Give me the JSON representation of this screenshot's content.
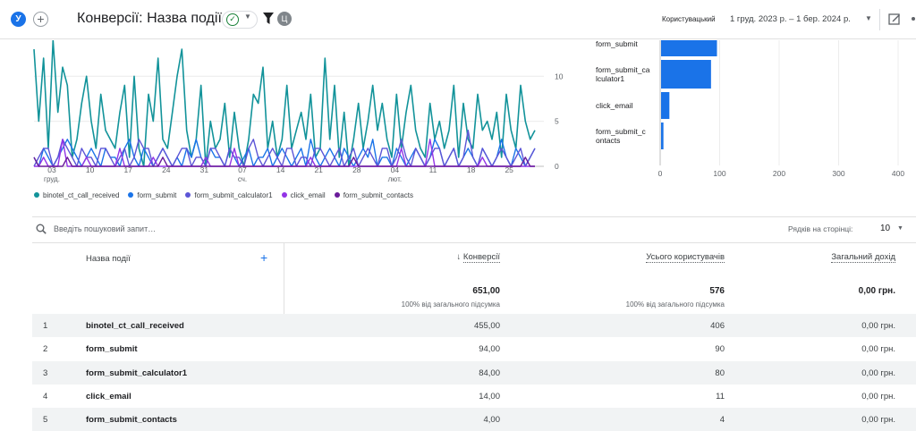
{
  "header": {
    "avatar": "У",
    "add": "+",
    "title": "Конверсії: Назва події",
    "filter_chip": "Ц",
    "comparison_label": "Користувацький",
    "date_range": "1 груд. 2023 р. – 1 бер. 2024 р."
  },
  "colors": {
    "series": [
      "#12939a",
      "#1a73e8",
      "#5c55d6",
      "#9334e6",
      "#6a1b9a"
    ],
    "accent": "#1a73e8",
    "row_shade": "#f1f3f4"
  },
  "chart_data": [
    {
      "type": "line",
      "x_ticks": [
        {
          "day": "03",
          "month": "груд."
        },
        {
          "day": "10",
          "month": ""
        },
        {
          "day": "17",
          "month": ""
        },
        {
          "day": "24",
          "month": ""
        },
        {
          "day": "31",
          "month": ""
        },
        {
          "day": "07",
          "month": "сч."
        },
        {
          "day": "14",
          "month": ""
        },
        {
          "day": "21",
          "month": ""
        },
        {
          "day": "28",
          "month": ""
        },
        {
          "day": "04",
          "month": "лют."
        },
        {
          "day": "11",
          "month": ""
        },
        {
          "day": "18",
          "month": ""
        },
        {
          "day": "25",
          "month": ""
        }
      ],
      "y_ticks": [
        "0",
        "5",
        "10"
      ],
      "ylim": [
        0,
        14
      ],
      "series": [
        {
          "name": "binotel_ct_call_received",
          "values": [
            13,
            5,
            12,
            2,
            14,
            6,
            11,
            9,
            1,
            3,
            7,
            10,
            5,
            2,
            8,
            4,
            3,
            2,
            6,
            9,
            1,
            10,
            2,
            0,
            8,
            5,
            12,
            3,
            2,
            6,
            10,
            13,
            4,
            1,
            3,
            9,
            0,
            5,
            2,
            3,
            7,
            1,
            6,
            2,
            0,
            3,
            8,
            7,
            11,
            2,
            5,
            1,
            3,
            9,
            2,
            4,
            6,
            3,
            8,
            1,
            2,
            12,
            3,
            9,
            1,
            6,
            0,
            3,
            7,
            2,
            5,
            9,
            4,
            7,
            3,
            1,
            8,
            2,
            6,
            9,
            4,
            2,
            1,
            7,
            3,
            5,
            2,
            4,
            9,
            1,
            7,
            3,
            2,
            8,
            4,
            5,
            3,
            6,
            1,
            8,
            4,
            2,
            9,
            5,
            3,
            4
          ]
        },
        {
          "name": "form_submit",
          "values": [
            1,
            0,
            2,
            1,
            0,
            1,
            2,
            3,
            2,
            1,
            0,
            1,
            2,
            1,
            0,
            2,
            1,
            1,
            0,
            2,
            3,
            1,
            0,
            2,
            1,
            0,
            1,
            2,
            1,
            0,
            1,
            0,
            2,
            1,
            3,
            1,
            0,
            2,
            1,
            1,
            0,
            2,
            1,
            0,
            1,
            2,
            0,
            1,
            1,
            2,
            0,
            1,
            2,
            1,
            0,
            1,
            2,
            0,
            3,
            1,
            0,
            1,
            2,
            1,
            0,
            2,
            1,
            0,
            1,
            2,
            1,
            3,
            0,
            1,
            1,
            0,
            2,
            1,
            0,
            1,
            2,
            1,
            0,
            1,
            3,
            2,
            0,
            1,
            2,
            0,
            1,
            2,
            1,
            0,
            2,
            1,
            0,
            1,
            3,
            1,
            0,
            2,
            1,
            0,
            1,
            2
          ]
        },
        {
          "name": "form_submit_calculator1",
          "values": [
            0,
            1,
            2,
            2,
            0,
            1,
            3,
            2,
            1,
            0,
            2,
            1,
            1,
            0,
            2,
            2,
            1,
            0,
            1,
            2,
            0,
            1,
            3,
            2,
            2,
            0,
            1,
            2,
            1,
            0,
            1,
            2,
            2,
            0,
            1,
            1,
            0,
            2,
            2,
            1,
            0,
            2,
            1,
            1,
            0,
            2,
            3,
            1,
            0,
            1,
            2,
            1,
            0,
            2,
            2,
            0,
            1,
            1,
            0,
            2,
            2,
            1,
            0,
            1,
            2,
            0,
            1,
            2,
            0,
            1,
            2,
            1,
            0,
            2,
            2,
            0,
            1,
            3,
            1,
            0,
            2,
            1,
            0,
            1,
            2,
            2,
            0,
            1,
            2,
            0,
            1,
            4,
            1,
            0,
            2,
            1,
            0,
            1,
            2,
            1,
            0,
            1,
            2,
            0,
            1,
            2
          ]
        },
        {
          "name": "click_email",
          "values": [
            0,
            0,
            1,
            0,
            0,
            0,
            3,
            0,
            0,
            0,
            0,
            1,
            0,
            0,
            0,
            0,
            0,
            0,
            2,
            0,
            0,
            0,
            0,
            0,
            0,
            1,
            0,
            0,
            0,
            0,
            0,
            0,
            0,
            0,
            0,
            0,
            1,
            0,
            0,
            0,
            0,
            0,
            2,
            0,
            0,
            0,
            0,
            0,
            0,
            0,
            0,
            0,
            0,
            0,
            0,
            0,
            0,
            0,
            1,
            0,
            0,
            0,
            0,
            0,
            0,
            0,
            0,
            0,
            0,
            0,
            0,
            0,
            0,
            0,
            0,
            0,
            0,
            2,
            0,
            0,
            0,
            0,
            0,
            3,
            0,
            0,
            0,
            0,
            0,
            0,
            0,
            0,
            0,
            0,
            1,
            0,
            0,
            0,
            0,
            0,
            0,
            0,
            0,
            0,
            0,
            0
          ]
        },
        {
          "name": "form_submit_contacts",
          "values": [
            1,
            0,
            0,
            0,
            0,
            0,
            0,
            1,
            0,
            0,
            0,
            0,
            0,
            0,
            0,
            0,
            0,
            0,
            0,
            0,
            0,
            0,
            0,
            0,
            0,
            0,
            0,
            1,
            0,
            0,
            0,
            0,
            0,
            0,
            0,
            0,
            0,
            0,
            0,
            0,
            0,
            0,
            0,
            0,
            0,
            0,
            0,
            0,
            0,
            0,
            0,
            0,
            0,
            0,
            0,
            0,
            0,
            0,
            0,
            0,
            0,
            0,
            0,
            0,
            0,
            0,
            0,
            1,
            0,
            0,
            0,
            0,
            0,
            0,
            0,
            0,
            0,
            0,
            0,
            0,
            0,
            0,
            0,
            0,
            0,
            0,
            0,
            0,
            0,
            0,
            0,
            0,
            0,
            0,
            0,
            0,
            0,
            0,
            0,
            0,
            0,
            0,
            0,
            1,
            0,
            0
          ]
        }
      ]
    },
    {
      "type": "bar",
      "orientation": "horizontal",
      "categories": [
        "form_submit",
        "form_submit_calculator1",
        "click_email",
        "form_submit_contacts"
      ],
      "category_labels": [
        [
          "form_submit"
        ],
        [
          "form_submit_ca",
          "lculator1"
        ],
        [
          "click_email"
        ],
        [
          "form_submit_c",
          "ontacts"
        ]
      ],
      "values": [
        94,
        84,
        14,
        4
      ],
      "x_ticks": [
        "0",
        "100",
        "200",
        "300",
        "400"
      ],
      "xlim": [
        0,
        400
      ]
    }
  ],
  "table": {
    "search_placeholder": "Введіть пошуковий запит…",
    "rows_per_page_label": "Рядків на сторінці:",
    "rows_per_page": "10",
    "add_dimension": "+",
    "columns": {
      "name": "Назва події",
      "conversions": "Конверсії",
      "users": "Усього користувачів",
      "revenue": "Загальний дохід"
    },
    "sort_arrow": "↓",
    "totals": {
      "conversions": "651,00",
      "conversions_sub": "100% від загального підсумка",
      "users": "576",
      "users_sub": "100% від загального підсумка",
      "revenue": "0,00 грн."
    },
    "rows": [
      {
        "idx": "1",
        "name": "binotel_ct_call_received",
        "conversions": "455,00",
        "users": "406",
        "revenue": "0,00 грн."
      },
      {
        "idx": "2",
        "name": "form_submit",
        "conversions": "94,00",
        "users": "90",
        "revenue": "0,00 грн."
      },
      {
        "idx": "3",
        "name": "form_submit_calculator1",
        "conversions": "84,00",
        "users": "80",
        "revenue": "0,00 грн."
      },
      {
        "idx": "4",
        "name": "click_email",
        "conversions": "14,00",
        "users": "11",
        "revenue": "0,00 грн."
      },
      {
        "idx": "5",
        "name": "form_submit_contacts",
        "conversions": "4,00",
        "users": "4",
        "revenue": "0,00 грн."
      }
    ]
  }
}
